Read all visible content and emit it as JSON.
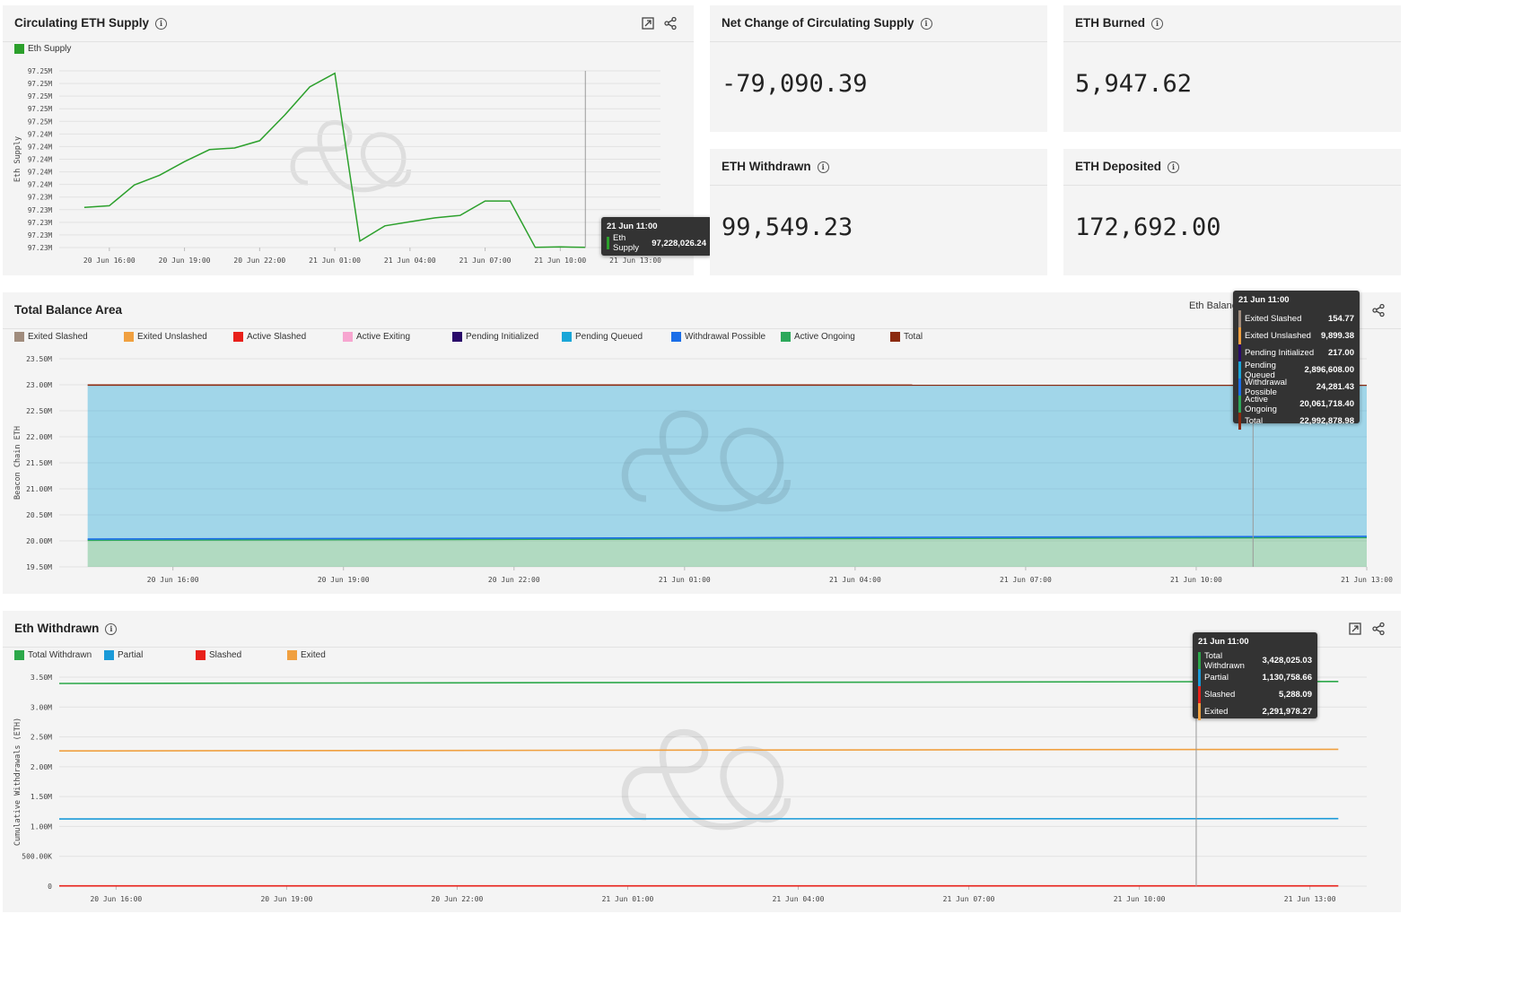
{
  "supply_panel": {
    "title": "Circulating ETH Supply",
    "legend": "Eth Supply",
    "tooltip": {
      "title": "21 Jun 11:00",
      "label": "Eth Supply",
      "value": "97,228,026.24"
    }
  },
  "kpis": {
    "net_change": {
      "title": "Net Change of Circulating Supply",
      "value": "-79,090.39"
    },
    "burned": {
      "title": "ETH Burned",
      "value": "5,947.62"
    },
    "withdrawn": {
      "title": "ETH Withdrawn",
      "value": "99,549.23"
    },
    "deposited": {
      "title": "ETH Deposited",
      "value": "172,692.00"
    }
  },
  "balance_panel": {
    "title": "Total Balance Area",
    "dropdown_label": "Eth Balanc",
    "tooltip": {
      "title": "21 Jun 11:00",
      "rows": [
        {
          "label": "Exited Slashed",
          "value": "154.77",
          "color": "#a08c7d"
        },
        {
          "label": "Exited Unslashed",
          "value": "9,899.38",
          "color": "#f0a040"
        },
        {
          "label": "Pending Initialized",
          "value": "217.00",
          "color": "#2a0a6a"
        },
        {
          "label": "Pending Queued",
          "value": "2,896,608.00",
          "color": "#1aa6d8"
        },
        {
          "label": "Withdrawal Possible",
          "value": "24,281.43",
          "color": "#1a6ee8"
        },
        {
          "label": "Active Ongoing",
          "value": "20,061,718.40",
          "color": "#2ca85a"
        },
        {
          "label": "Total",
          "value": "22,992,878.98",
          "color": "#8b2a10"
        }
      ]
    }
  },
  "withdrawn_panel": {
    "title": "Eth Withdrawn",
    "tooltip": {
      "title": "21 Jun 11:00",
      "rows": [
        {
          "label": "Total Withdrawn",
          "value": "3,428,025.03",
          "color": "#2ca84a"
        },
        {
          "label": "Partial",
          "value": "1,130,758.66",
          "color": "#1a9ad8"
        },
        {
          "label": "Slashed",
          "value": "5,288.09",
          "color": "#e8201a"
        },
        {
          "label": "Exited",
          "value": "2,291,978.27",
          "color": "#f0a040"
        }
      ]
    }
  },
  "chart_data": [
    {
      "type": "line",
      "title": "Circulating ETH Supply",
      "xlabel": "",
      "ylabel": "Eth Supply",
      "x_tick_labels": [
        "20 Jun 16:00",
        "20 Jun 19:00",
        "20 Jun 22:00",
        "21 Jun 01:00",
        "21 Jun 04:00",
        "21 Jun 07:00",
        "21 Jun 10:00",
        "21 Jun 13:00"
      ],
      "y_tick_labels": [
        "97.23M",
        "97.23M",
        "97.23M",
        "97.23M",
        "97.23M",
        "97.24M",
        "97.24M",
        "97.24M",
        "97.24M",
        "97.24M",
        "97.25M",
        "97.25M",
        "97.25M",
        "97.25M",
        "97.25M"
      ],
      "ylim": [
        97228000,
        97250000
      ],
      "grid": true,
      "legend": "top-left",
      "series": [
        {
          "name": "Eth Supply",
          "color": "#2ca02c",
          "x": [
            "20 Jun 15:00",
            "20 Jun 16:00",
            "20 Jun 17:00",
            "20 Jun 18:00",
            "20 Jun 19:00",
            "20 Jun 20:00",
            "20 Jun 21:00",
            "20 Jun 22:00",
            "20 Jun 23:00",
            "21 Jun 00:00",
            "21 Jun 01:00",
            "21 Jun 02:00",
            "21 Jun 03:00",
            "21 Jun 04:00",
            "21 Jun 05:00",
            "21 Jun 06:00",
            "21 Jun 07:00",
            "21 Jun 08:00",
            "21 Jun 09:00",
            "21 Jun 10:00",
            "21 Jun 11:00"
          ],
          "values": [
            97233000,
            97233200,
            97235800,
            97237000,
            97238700,
            97240200,
            97240400,
            97241300,
            97244500,
            97248000,
            97249700,
            97228800,
            97230700,
            97231200,
            97231700,
            97232000,
            97233800,
            97233800,
            97228020,
            97228080,
            97228026
          ]
        }
      ]
    },
    {
      "type": "area",
      "title": "Total Balance Area",
      "xlabel": "",
      "ylabel": "Beacon Chain ETH",
      "x_tick_labels": [
        "20 Jun 16:00",
        "20 Jun 19:00",
        "20 Jun 22:00",
        "21 Jun 01:00",
        "21 Jun 04:00",
        "21 Jun 07:00",
        "21 Jun 10:00",
        "21 Jun 13:00"
      ],
      "y_tick_labels": [
        "19.50M",
        "20.00M",
        "20.50M",
        "21.00M",
        "21.50M",
        "22.00M",
        "22.50M",
        "23.00M",
        "23.50M"
      ],
      "ylim": [
        19500000,
        23500000
      ],
      "grid": true,
      "legend": "top",
      "x_range": [
        "20 Jun 14:00",
        "21 Jun 13:00"
      ],
      "series": [
        {
          "name": "Exited Slashed",
          "color": "#a08c7d",
          "values_start": 154.77,
          "values_end": 154.77
        },
        {
          "name": "Exited Unslashed",
          "color": "#f0a040",
          "values_start": 9899.38,
          "values_end": 9899.38
        },
        {
          "name": "Active Slashed",
          "color": "#e8201a",
          "values_start": 0,
          "values_end": 0
        },
        {
          "name": "Active Exiting",
          "color": "#f7a6d0",
          "values_start": 0,
          "values_end": 0
        },
        {
          "name": "Pending Initialized",
          "color": "#2a0a6a",
          "values_start": 217,
          "values_end": 217
        },
        {
          "name": "Pending Queued",
          "color": "#1aa6d8",
          "values_start": 2950000,
          "values_end": 2896608
        },
        {
          "name": "Withdrawal Possible",
          "color": "#1a6ee8",
          "values_start": 24000,
          "values_end": 24281.43
        },
        {
          "name": "Active Ongoing",
          "color": "#2ca85a",
          "values_start": 20010000,
          "values_end": 20061718.4
        },
        {
          "name": "Total",
          "color": "#8b2a10",
          "values_start": 22995000,
          "values_end": 22992878.98
        }
      ]
    },
    {
      "type": "line",
      "title": "Eth Withdrawn",
      "xlabel": "",
      "ylabel": "Cumulative Withdrawals (ETH)",
      "x_tick_labels": [
        "20 Jun 16:00",
        "20 Jun 19:00",
        "20 Jun 22:00",
        "21 Jun 01:00",
        "21 Jun 04:00",
        "21 Jun 07:00",
        "21 Jun 10:00",
        "21 Jun 13:00"
      ],
      "y_tick_labels": [
        "0",
        "500.00K",
        "1.00M",
        "1.50M",
        "2.00M",
        "2.50M",
        "3.00M",
        "3.50M"
      ],
      "ylim": [
        0,
        3500000
      ],
      "grid": true,
      "legend": "top-left",
      "x_range": [
        "20 Jun 15:00",
        "21 Jun 14:00"
      ],
      "series": [
        {
          "name": "Total Withdrawn",
          "color": "#2ca84a",
          "values_start": 3395000,
          "values_end": 3428025.03
        },
        {
          "name": "Partial",
          "color": "#1a9ad8",
          "values_start": 1125000,
          "values_end": 1130758.66
        },
        {
          "name": "Slashed",
          "color": "#e8201a",
          "values_start": 5250,
          "values_end": 5288.09
        },
        {
          "name": "Exited",
          "color": "#f0a040",
          "values_start": 2265000,
          "values_end": 2291978.27
        }
      ]
    }
  ]
}
